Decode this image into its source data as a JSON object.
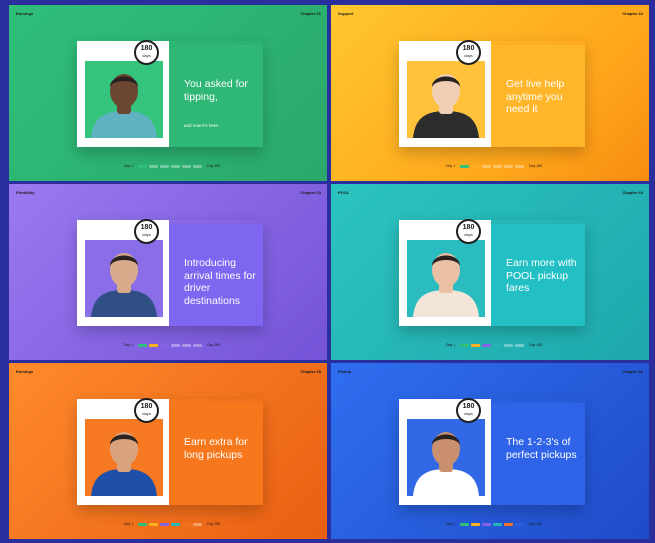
{
  "panels": [
    {
      "section": "Earnings",
      "chapter": "Chapter 61",
      "badge_number": "180",
      "badge_unit": "days",
      "headline": "You asked for tipping,",
      "subline": "and now it's here.",
      "progress_start": "Day 1",
      "progress_end": "Day 180",
      "background": "#2fbf7a",
      "text_panel_color": "#2fb775",
      "photo_bg": "#34c47e",
      "skin": "#6b4631",
      "shirt": "#5fb3c0",
      "progress_done": 1
    },
    {
      "section": "Support",
      "chapter": "Chapter 62",
      "badge_number": "180",
      "badge_unit": "days",
      "headline": "Get live help anytime you need it",
      "subline": "",
      "progress_start": "Day 1",
      "progress_end": "Day 180",
      "background": "#ffb020",
      "text_panel_color": "#ffb62a",
      "photo_bg": "#ffc23a",
      "skin": "#f1cfb5",
      "shirt": "#2c2c2c",
      "progress_done": 2
    },
    {
      "section": "Flexibility",
      "chapter": "Chapter 63",
      "badge_number": "180",
      "badge_unit": "days",
      "headline": "Introducing arrival times for driver destinations",
      "subline": "",
      "progress_start": "Day 1",
      "progress_end": "Day 180",
      "background": "#8464e4",
      "text_panel_color": "#7f66f0",
      "photo_bg": "#8a6ee8",
      "skin": "#d8a98a",
      "shirt": "#2f4f86",
      "progress_done": 3
    },
    {
      "section": "POOL",
      "chapter": "Chapter 64",
      "badge_number": "180",
      "badge_unit": "days",
      "headline": "Earn more with POOL pickup fares",
      "subline": "",
      "progress_start": "Day 1",
      "progress_end": "Day 180",
      "background": "#26b6b6",
      "text_panel_color": "#22c0c4",
      "photo_bg": "#2bbcc0",
      "skin": "#e9c0a4",
      "shirt": "#f3e6d8",
      "progress_done": 4
    },
    {
      "section": "Earnings",
      "chapter": "Chapter 65",
      "badge_number": "180",
      "badge_unit": "days",
      "headline": "Earn extra for long pickups",
      "subline": "",
      "progress_start": "Day 1",
      "progress_end": "Day 180",
      "background": "#f4741f",
      "text_panel_color": "#f7781c",
      "photo_bg": "#f77a22",
      "skin": "#d9a37e",
      "shirt": "#1f4fa8",
      "progress_done": 5
    },
    {
      "section": "Pickup",
      "chapter": "Chapter 66",
      "badge_number": "180",
      "badge_unit": "days",
      "headline": "The 1-2-3's of perfect pickups",
      "subline": "",
      "progress_start": "Day 1",
      "progress_end": "Day 180",
      "background": "#2a5fe0",
      "text_panel_color": "#2f64e8",
      "photo_bg": "#3068e6",
      "skin": "#c98f6e",
      "shirt": "#ffffff",
      "progress_done": 6
    }
  ],
  "progress_colors": [
    "#2fbf7a",
    "#ffb020",
    "#8464e4",
    "#26b6b6",
    "#f4741f",
    "#2a5fe0"
  ]
}
